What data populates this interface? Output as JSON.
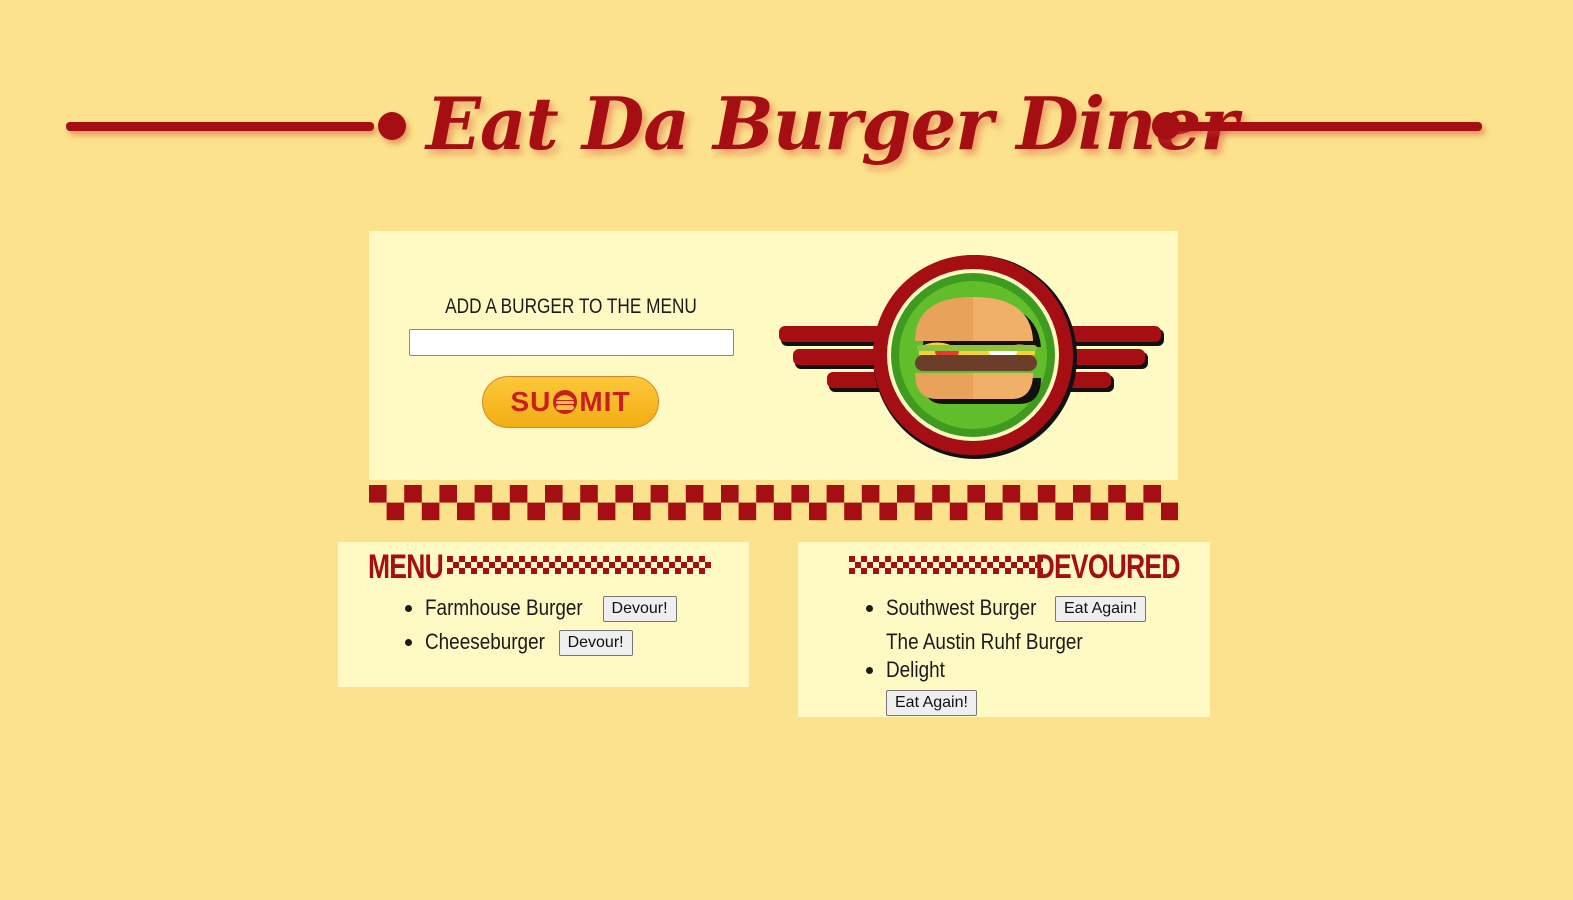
{
  "header": {
    "title": "Eat Da Burger Diner"
  },
  "add_form": {
    "label": "ADD A BURGER TO THE MENU",
    "input_value": "",
    "submit_label_pre": "SU",
    "submit_label_post": "MIT"
  },
  "menu": {
    "heading": "MENU",
    "items": [
      {
        "name": "Farmhouse Burger",
        "button": "Devour!"
      },
      {
        "name": "Cheeseburger",
        "button": "Devour!"
      }
    ]
  },
  "devoured": {
    "heading": "DEVOURED",
    "items": [
      {
        "name": "Southwest Burger",
        "button": "Eat Again!"
      },
      {
        "name": "The Austin Ruhf Burger Delight",
        "button": "Eat Again!"
      }
    ]
  },
  "colors": {
    "background": "#fce28d",
    "panel": "#fffac3",
    "accent_red": "#a50f14",
    "submit_yellow": "#f2ad14"
  }
}
